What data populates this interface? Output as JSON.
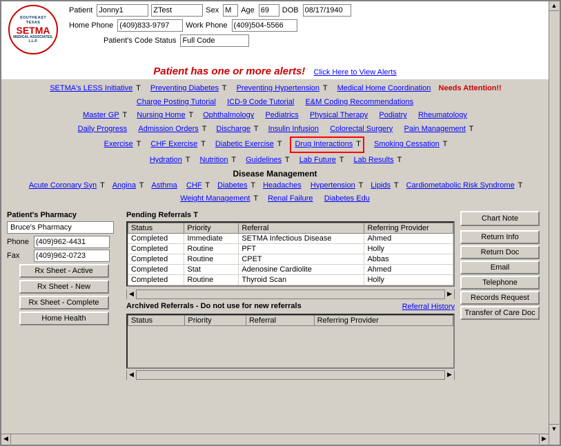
{
  "window": {
    "title": "Southeast Texas Medical Associates"
  },
  "logo": {
    "line1": "SOUTHEAST TEXAS",
    "line2": "SETMA",
    "line3": "MEDICAL ASSOCIATES, L.L.P."
  },
  "patient": {
    "label_patient": "Patient",
    "first_name": "Jonny1",
    "last_name": "ZTest",
    "sex_label": "Sex",
    "sex": "M",
    "age_label": "Age",
    "age": "69",
    "dob_label": "DOB",
    "dob": "08/17/1940",
    "home_phone_label": "Home Phone",
    "home_phone": "(409)833-9797",
    "work_phone_label": "Work Phone",
    "work_phone": "(409)504-5566",
    "code_status_label": "Patient's Code Status",
    "code_status": "Full Code"
  },
  "alert": {
    "message": "Patient has one or more alerts!",
    "link_text": "Click Here to View Alerts"
  },
  "nav": {
    "row1": [
      {
        "label": "SETMA's LESS Initiative",
        "t": "T"
      },
      {
        "label": "Preventing Diabetes",
        "t": "T"
      },
      {
        "label": "Preventing Hypertension",
        "t": "T"
      },
      {
        "label": "Medical Home Coordination"
      }
    ],
    "row1_needs": "Needs Attention!!",
    "row2": [
      {
        "label": "Charge Posting Tutorial"
      },
      {
        "label": "ICD-9 Code Tutorial"
      },
      {
        "label": "E&M Coding Recommendations"
      }
    ],
    "row3": [
      {
        "label": "Master GP",
        "t": "T"
      },
      {
        "label": "Nursing Home",
        "t": "T"
      },
      {
        "label": "Ophthalmology"
      },
      {
        "label": "Pediatrics"
      },
      {
        "label": "Physical Therapy"
      },
      {
        "label": "Podiatry"
      },
      {
        "label": "Rheumatology"
      }
    ],
    "row4": [
      {
        "label": "Daily Progress"
      },
      {
        "label": "Admission Orders",
        "t": "T"
      },
      {
        "label": "Discharge",
        "t": "T"
      },
      {
        "label": "Insulin Infusion"
      },
      {
        "label": "Colorectal Surgery"
      },
      {
        "label": "Pain Management",
        "t": "T"
      }
    ],
    "row5": [
      {
        "label": "Exercise",
        "t": "T"
      },
      {
        "label": "CHF Exercise",
        "t": "T"
      },
      {
        "label": "Diabetic Exercise",
        "t": "T"
      },
      {
        "label": "Drug Interactions",
        "t": "T",
        "boxed": true
      },
      {
        "label": "Smoking Cessation",
        "t": "T"
      }
    ],
    "row6": [
      {
        "label": "Hydration",
        "t": "T"
      },
      {
        "label": "Nutrition",
        "t": "T"
      },
      {
        "label": "Guidelines",
        "t": "T"
      },
      {
        "label": "Lab Future",
        "t": "T"
      },
      {
        "label": "Lab Results",
        "t": "T"
      }
    ],
    "disease_mgmt": "Disease Management",
    "row7": [
      {
        "label": "Acute Coronary Syn",
        "t": "T"
      },
      {
        "label": "Angina",
        "t": "T"
      },
      {
        "label": "Asthma"
      },
      {
        "label": "CHF",
        "t": "T"
      },
      {
        "label": "Diabetes",
        "t": "T"
      },
      {
        "label": "Headaches"
      },
      {
        "label": "Hypertension",
        "t": "T"
      },
      {
        "label": "Lipids",
        "t": "T"
      },
      {
        "label": "Cardiometabolic Risk Syndrome",
        "t": "T"
      }
    ],
    "row8": [
      {
        "label": "Weight Management",
        "t": "T"
      },
      {
        "label": "Renal Failure"
      },
      {
        "label": "Diabetes Edu"
      }
    ]
  },
  "pharmacy": {
    "title": "Patient's Pharmacy",
    "name": "Bruce's Pharmacy",
    "phone_label": "Phone",
    "phone": "(409)962-4431",
    "fax_label": "Fax",
    "fax": "(409)962-0723",
    "btn_active": "Rx Sheet - Active",
    "btn_new": "Rx Sheet - New",
    "btn_complete": "Rx Sheet - Complete",
    "btn_home_health": "Home Health"
  },
  "pending_referrals": {
    "title": "Pending Referrals",
    "t": "T",
    "columns": [
      "Status",
      "Priority",
      "Referral",
      "Referring Provider"
    ],
    "rows": [
      {
        "status": "Completed",
        "priority": "Immediate",
        "referral": "SETMA Infectious Disease",
        "provider": "Ahmed"
      },
      {
        "status": "Completed",
        "priority": "Routine",
        "referral": "PFT",
        "provider": "Holly"
      },
      {
        "status": "Completed",
        "priority": "Routine",
        "referral": "CPET",
        "provider": "Abbas"
      },
      {
        "status": "Completed",
        "priority": "Stat",
        "referral": "Adenosine Cardiolite",
        "provider": "Ahmed"
      },
      {
        "status": "Completed",
        "priority": "Routine",
        "referral": "Thyroid Scan",
        "provider": "Holly"
      }
    ]
  },
  "archived_referrals": {
    "title": "Archived Referrals - Do not use for new referrals",
    "link": "Referral History",
    "columns": [
      "Status",
      "Priority",
      "Referral",
      "Referring Provider"
    ],
    "rows": []
  },
  "right_panel": {
    "chart_note": "Chart Note",
    "return_info": "Return Info",
    "return_doc": "Return Doc",
    "email": "Email",
    "telephone": "Telephone",
    "records_request": "Records Request",
    "transfer_of_care": "Transfer of Care Doc"
  }
}
